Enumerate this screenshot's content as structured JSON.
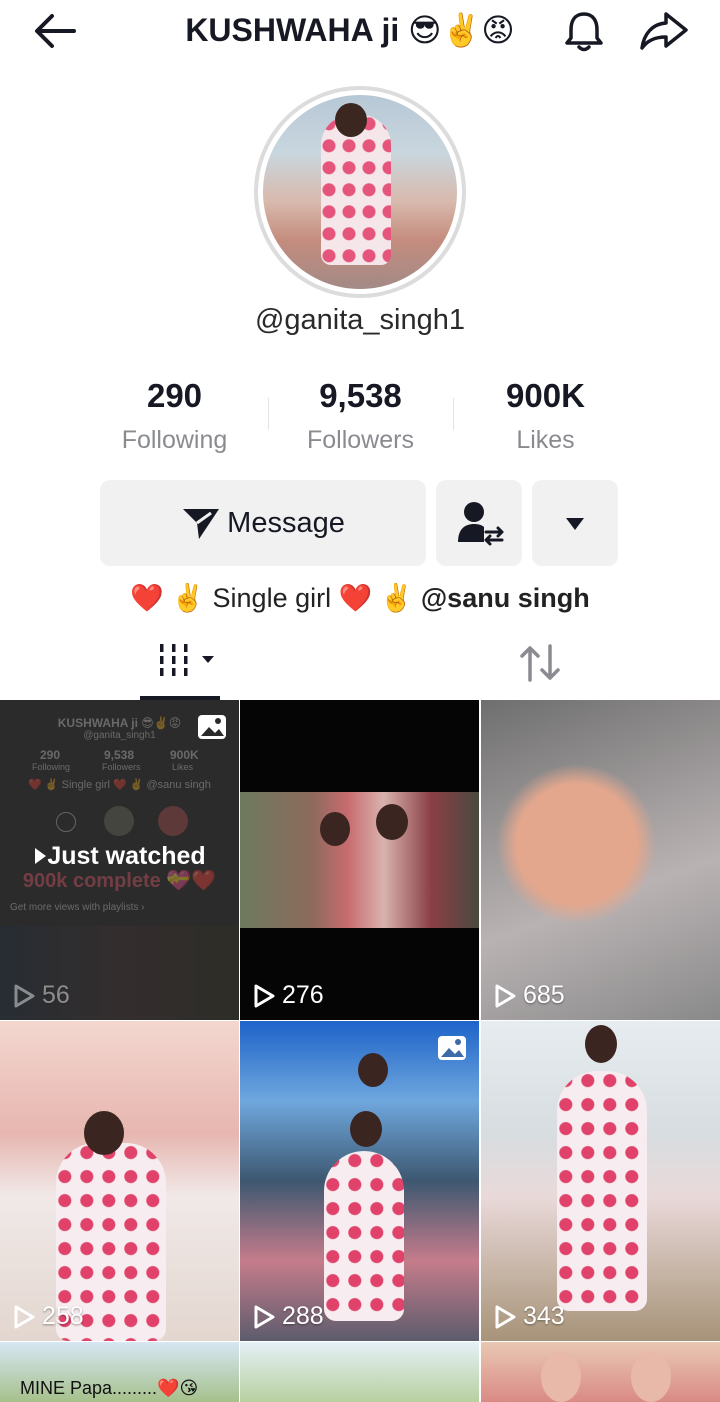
{
  "header": {
    "title": "KUSHWAHA ji 😎✌️😡",
    "back_icon": "back-arrow-icon",
    "notification_icon": "bell-icon",
    "share_icon": "share-icon"
  },
  "profile": {
    "username": "@ganita_singh1",
    "stats": [
      {
        "value": "290",
        "label": "Following"
      },
      {
        "value": "9,538",
        "label": "Followers"
      },
      {
        "value": "900K",
        "label": "Likes"
      }
    ],
    "buttons": {
      "message_label": "Message",
      "message_icon": "paper-plane-icon",
      "friend_icon": "friend-swap-icon",
      "more_icon": "triangle-down-icon"
    },
    "bio": {
      "text": "❤️ ✌️ Single girl ❤️ ✌️",
      "mention": "@sanu singh"
    }
  },
  "tabs": {
    "videos_icon": "grid-bars-icon",
    "repost_icon": "repost-icon"
  },
  "grid": {
    "first_cell": {
      "label": "Just watched",
      "views": "56",
      "ghost": {
        "title": "KUSHWAHA ji 😎✌️😡",
        "handle": "@ganita_singh1",
        "stats": [
          "290",
          "9,538",
          "900K"
        ],
        "stat_labels": [
          "Following",
          "Followers",
          "Likes"
        ],
        "bio": "❤️ ✌️ Single girl ❤️ ✌️ @sanu singh",
        "caption": "900k complete 💝❤️",
        "playlist": "Get more views with playlists ›"
      }
    },
    "cells": [
      {
        "views": "276"
      },
      {
        "views": "685"
      },
      {
        "views": "258"
      },
      {
        "views": "288"
      },
      {
        "views": "343"
      }
    ],
    "caption_cell": "MINE Papa.........❤️😘"
  }
}
